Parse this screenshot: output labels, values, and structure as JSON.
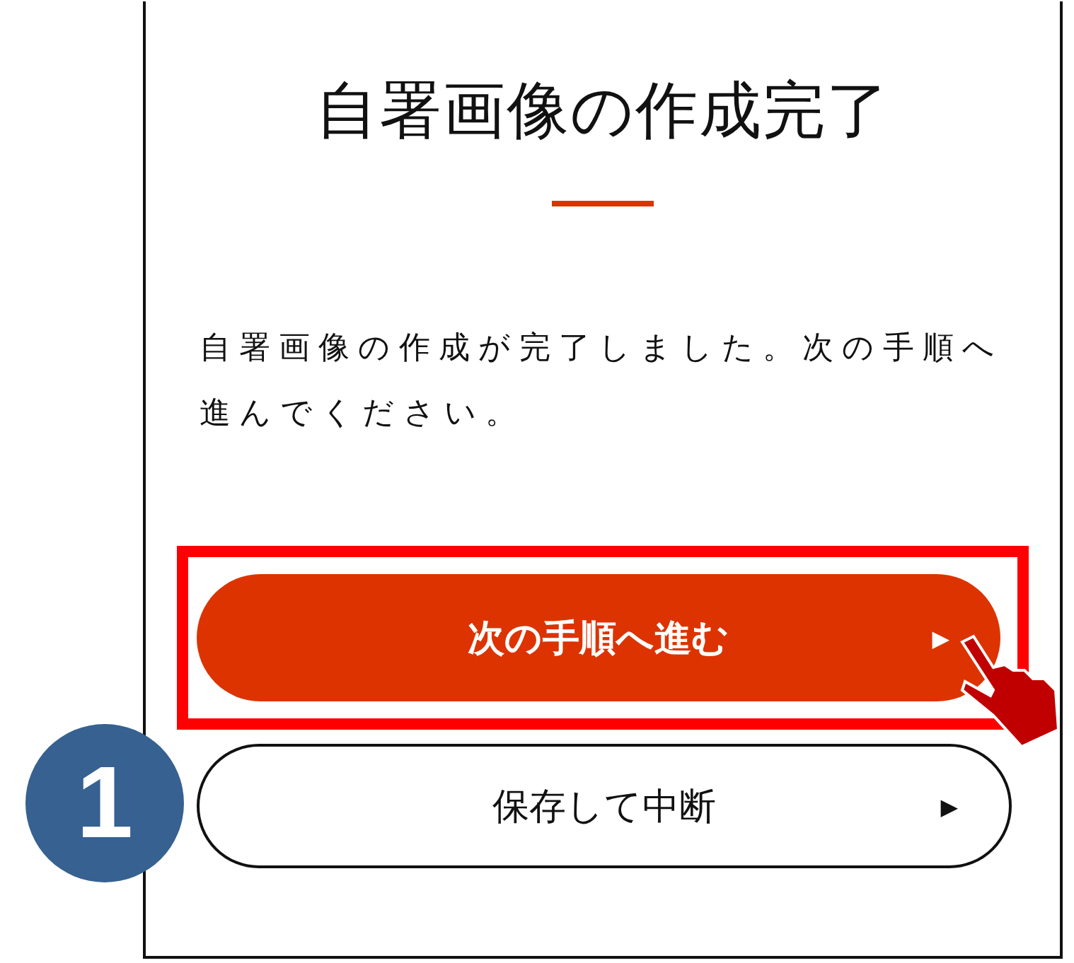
{
  "screen": {
    "title": "自署画像の作成完了",
    "message": "自署画像の作成が完了しました。次の手順へ進んでください。"
  },
  "buttons": [
    {
      "label": "次の手順へ進む",
      "arrow": "▶",
      "kind": "primary",
      "highlighted": true
    },
    {
      "label": "保存して中断",
      "arrow": "▶",
      "kind": "secondary",
      "highlighted": false
    }
  ],
  "step_badge": "1"
}
